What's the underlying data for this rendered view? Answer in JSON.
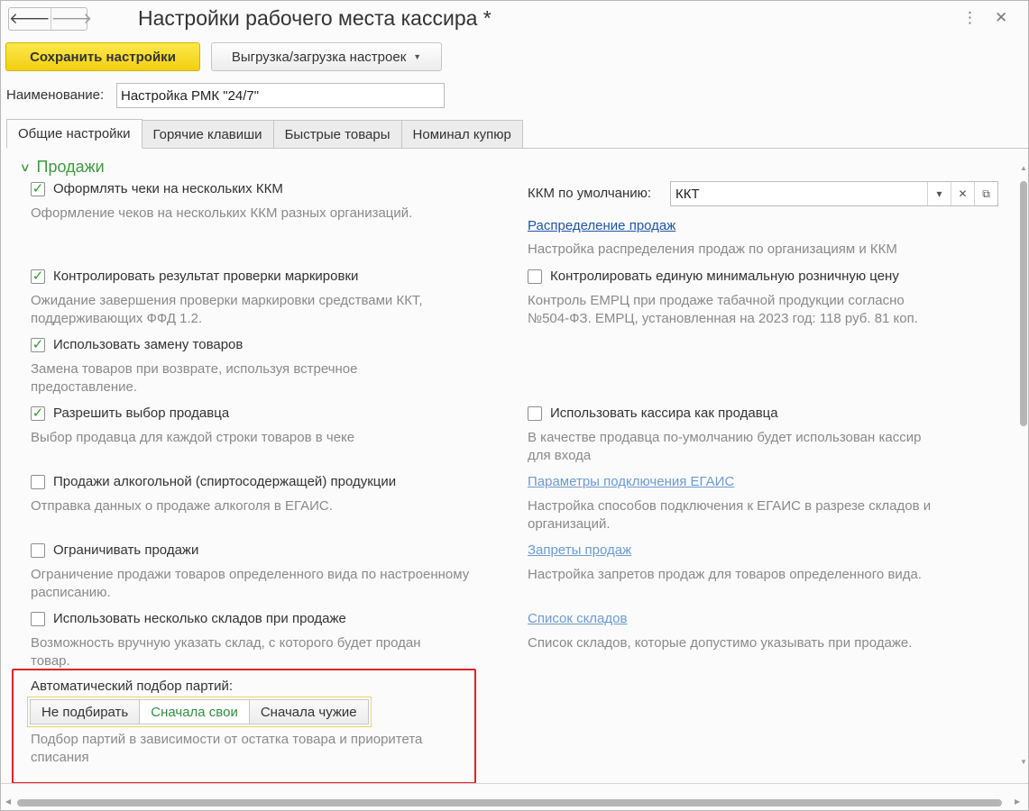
{
  "window": {
    "title": "Настройки рабочего места кассира *",
    "more_icon": "⋮",
    "close_icon": "✕"
  },
  "nav": {
    "back_icon": "🡐",
    "forward_icon": "🡒"
  },
  "toolbar": {
    "save_label": "Сохранить настройки",
    "export_label": "Выгрузка/загрузка настроек",
    "export_caret": "▼"
  },
  "name": {
    "label": "Наименование:",
    "value": "Настройка РМК \"24/7\""
  },
  "tabs": [
    {
      "label": "Общие настройки",
      "active": true
    },
    {
      "label": "Горячие клавиши"
    },
    {
      "label": "Быстрые товары"
    },
    {
      "label": "Номинал купюр"
    }
  ],
  "section": {
    "title": "Продажи",
    "chevron": "∨"
  },
  "left": [
    {
      "label": "Оформлять чеки на нескольких ККМ",
      "checked": true,
      "desc": [
        "Оформление чеков на нескольких ККМ разных организаций."
      ]
    },
    {
      "label": "Контролировать результат проверки маркировки",
      "checked": true,
      "desc": [
        "Ожидание завершения проверки маркировки средствами ККТ,",
        "поддерживающих ФФД 1.2."
      ]
    },
    {
      "label": "Использовать замену товаров",
      "checked": true,
      "desc": [
        "Замена товаров при возврате, используя встречное",
        "предоставление."
      ]
    },
    {
      "label": "Разрешить выбор продавца",
      "checked": true,
      "desc": [
        "Выбор продавца для каждой строки товаров в чеке"
      ]
    },
    {
      "label": "Продажи алкогольной (спиртосодержащей) продукции",
      "checked": false,
      "desc": [
        "Отправка данных о продаже алкоголя в ЕГАИС."
      ]
    },
    {
      "label": "Ограничивать продажи",
      "checked": false,
      "desc": [
        "Ограничение продажи товаров определенного вида по настроенному",
        "расписанию."
      ]
    },
    {
      "label": "Использовать несколько складов при продаже",
      "checked": false,
      "desc": [
        "Возможность вручную указать склад, с которого будет продан",
        "товар."
      ]
    }
  ],
  "right": {
    "kkm": {
      "label": "ККМ по умолчанию:",
      "value": "ККТ",
      "dropdown_icon": "▾",
      "clear_icon": "✕",
      "open_icon": "⧉"
    },
    "sales_dist": {
      "link": "Распределение продаж",
      "desc": [
        "Настройка распределения продаж по организациям и ККМ"
      ]
    },
    "mrp": {
      "label": "Контролировать единую минимальную розничную цену",
      "checked": false,
      "desc": [
        "Контроль ЕМРЦ при продаже табачной продукции согласно",
        "№504-ФЗ. ЕМРЦ, установленная на 2023 год: 118 руб. 81 коп."
      ]
    },
    "cashier": {
      "label": "Использовать кассира как продавца",
      "checked": false,
      "desc": [
        "В качестве продавца по-умолчанию будет использован кассир",
        "для входа"
      ]
    },
    "egais": {
      "link": "Параметры подключения ЕГАИС",
      "desc": [
        "Настройка способов подключения к ЕГАИС в разрезе складов и",
        "организаций."
      ]
    },
    "bans": {
      "link": "Запреты продаж",
      "desc": [
        "Настройка запретов продаж для товаров определенного вида."
      ]
    },
    "warehouses": {
      "link": "Список складов",
      "desc": [
        "Список складов, которые допустимо указывать при продаже."
      ]
    }
  },
  "batch": {
    "label": "Автоматический подбор партий:",
    "options": [
      "Не подбирать",
      "Сначала свои",
      "Сначала чужие"
    ],
    "selected": "Сначала свои",
    "desc": [
      "Подбор партий в зависимости от остатка товара и приоритета",
      "списания"
    ]
  },
  "scroll": {
    "up": "▲",
    "down": "▼",
    "left": "◀",
    "right": "▶"
  },
  "colors": {
    "accent_green": "#3d9b3d",
    "link_blue": "#1f55a4",
    "highlight_red": "#e0202a",
    "primary_yellow": "#f3cf12"
  }
}
